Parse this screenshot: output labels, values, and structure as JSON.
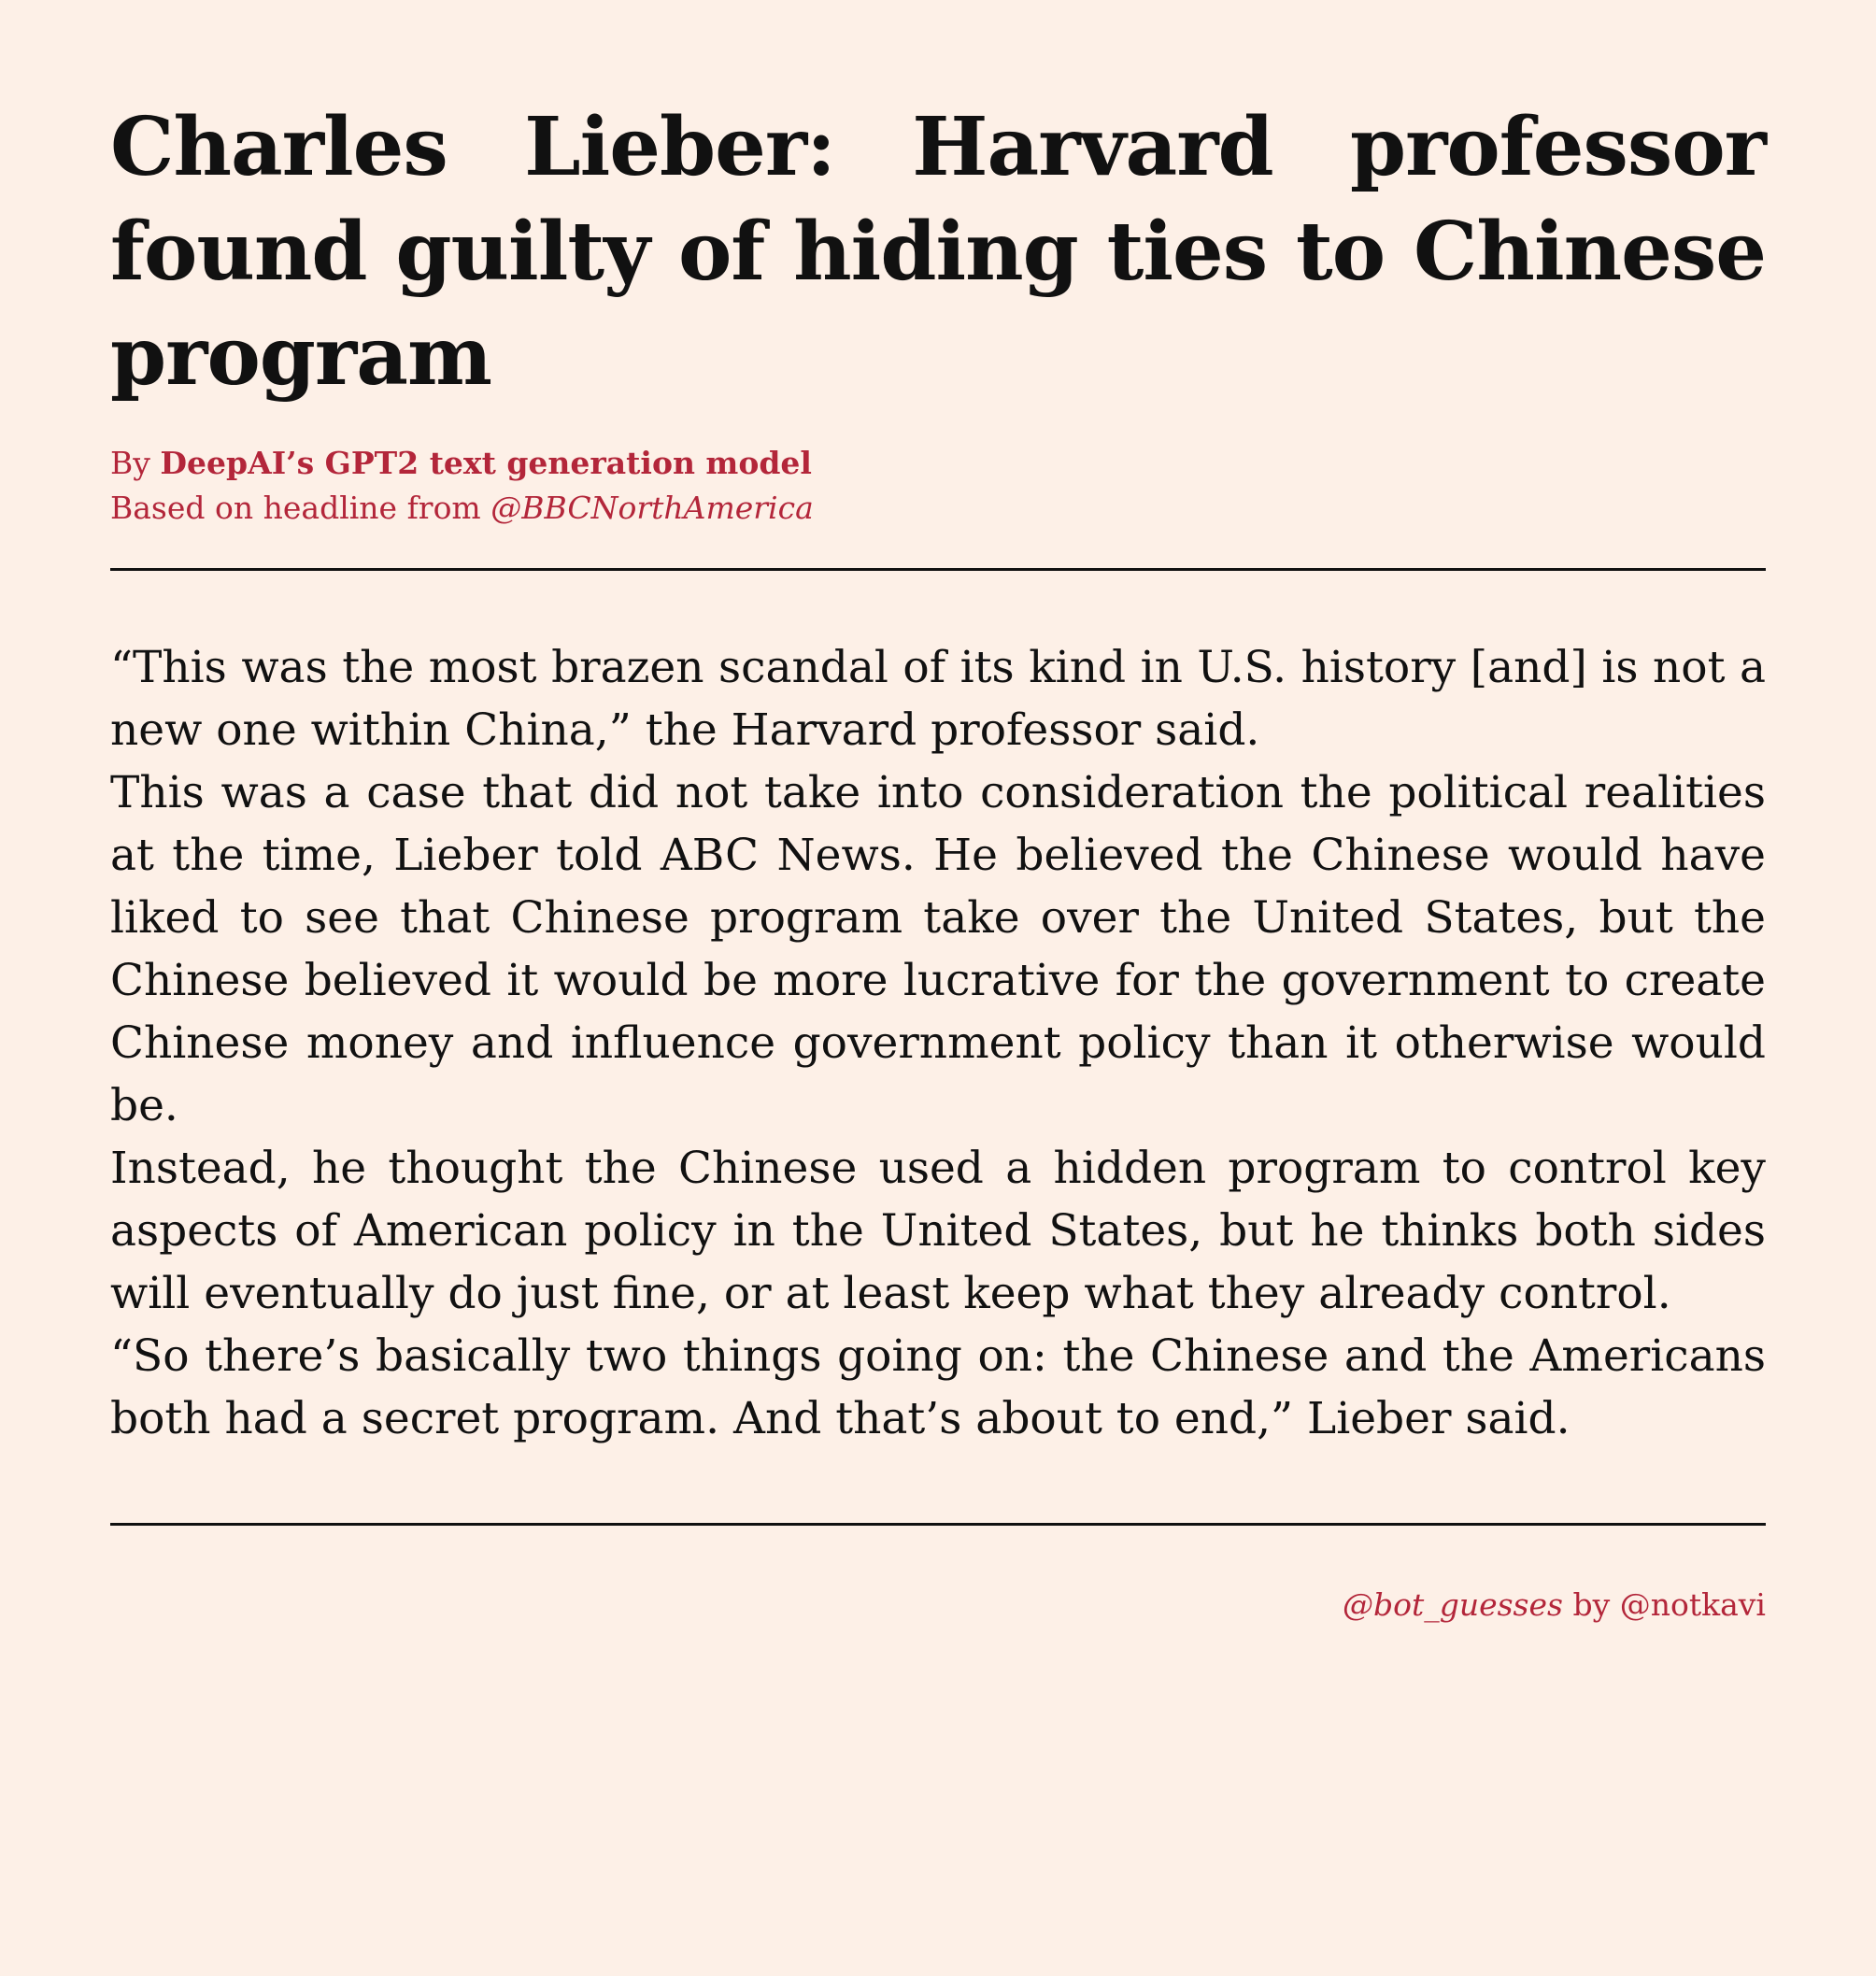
{
  "article": {
    "headline": "Charles Lieber: Harvard professor found guilty of hiding ties to Chinese program",
    "byline": {
      "prefix": "By",
      "author": "DeepAI’s GPT2 text generation model",
      "source_prefix": "Based on headline from",
      "source_handle": "@BBCNorthAmerica"
    },
    "paragraphs": [
      "“This was the most brazen scandal of its kind in U.S. history [and] is not a new one within China,” the Harvard professor said.",
      "This was a case that did not take into consideration the political realities at the time, Lieber told ABC News.  He believed the Chinese would have liked to see that Chinese program take over the United States, but the Chinese believed it would be more lucrative for the government to create Chinese money and influence government policy than it otherwise would be.",
      "Instead, he thought the Chinese used a hidden program to control key aspects of American policy in the United States, but he thinks both sides will eventually do just fine, or at least keep what they already control.",
      "“So there’s basically two things going on: the Chinese and the Americans both had a secret program.  And that’s about to end,” Lieber said."
    ]
  },
  "footer": {
    "bot_handle": "@bot_guesses",
    "by": "by",
    "creator_handle": "@notkavi"
  },
  "colors": {
    "background": "#fdf0e7",
    "accent": "#b3263a",
    "text": "#111111"
  }
}
